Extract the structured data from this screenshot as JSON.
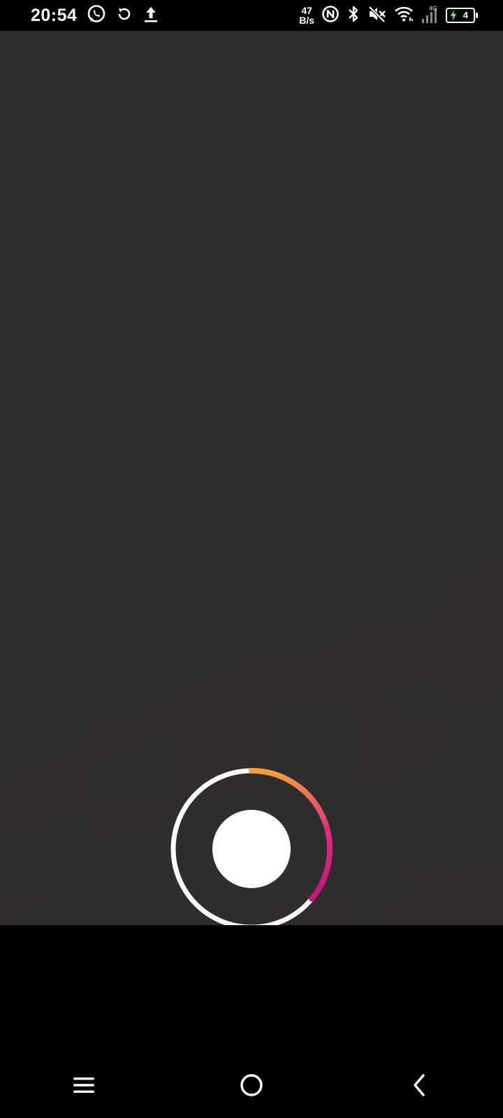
{
  "status_bar": {
    "time": "20:54",
    "network_speed_value": "47",
    "network_speed_unit": "B/s",
    "network_type": "4G",
    "battery_level": "4",
    "icons": [
      "whatsapp-icon",
      "sync-icon",
      "upload-icon",
      "nfc-icon",
      "bluetooth-icon",
      "mute-icon",
      "wifi-icon",
      "cellular-signal-icon",
      "battery-charging-icon"
    ]
  },
  "camera": {
    "record_progress": 0.36,
    "ring_colors": [
      "#f6a03a",
      "#e0307a",
      "#c8137f"
    ]
  },
  "nav_bar": {
    "icons": [
      "menu-icon",
      "home-icon",
      "back-icon"
    ]
  }
}
